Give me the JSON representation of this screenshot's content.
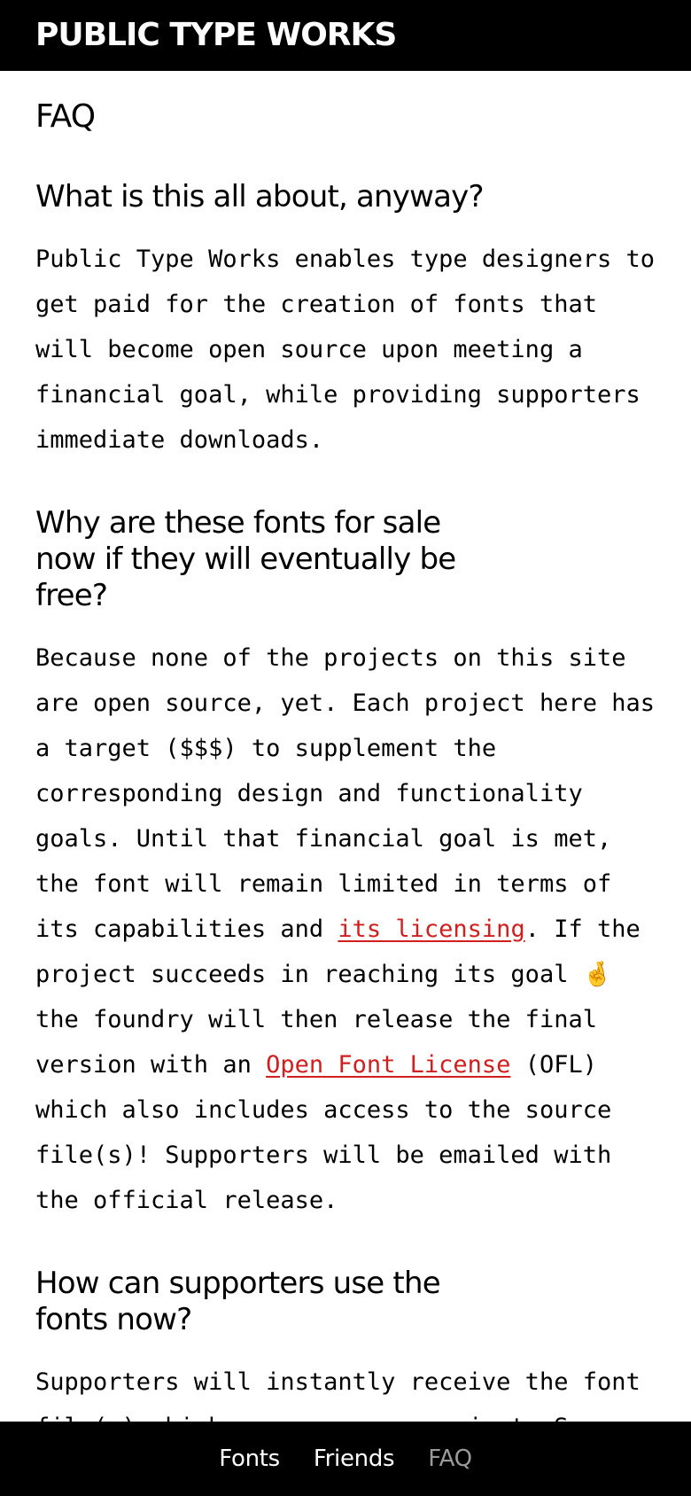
{
  "header": {
    "site_title": "PUBLIC TYPE WORKS"
  },
  "page": {
    "title": "FAQ"
  },
  "faq": [
    {
      "question": "What is this all about, anyway?",
      "answer": "Public Type Works enables type designers to get paid for the creation of fonts that will become open source upon meeting a financial goal, while providing supporters immediate downloads."
    },
    {
      "question": "Why are these fonts for sale now if they will eventually be free?",
      "answer_part1": "Because none of the projects on this site are open source, yet. Each project here has a target ($$$) to supplement the corresponding design and functionality goals. Until that financial goal is met, the font will remain limited in terms of its capabilities and ",
      "link_licensing": "its licensing",
      "answer_part2": ". If the project succeeds in reaching its goal 🤞 the foundry will then release the final version with an ",
      "link_ofl": "Open Font License",
      "answer_part3": " (OFL) which also includes access to the source file(s)! Supporters will be emailed with the official release."
    },
    {
      "question": "How can supporters use the fonts now?",
      "answer": "Supporters will instantly receive the font file(s) which may vary per project. Some"
    }
  ],
  "nav": {
    "items": [
      {
        "label": "Fonts",
        "active": false
      },
      {
        "label": "Friends",
        "active": false
      },
      {
        "label": "FAQ",
        "active": true
      }
    ]
  },
  "colors": {
    "header_bg": "#000000",
    "link": "#d11e1e",
    "nav_active": "#9a9a9a"
  }
}
